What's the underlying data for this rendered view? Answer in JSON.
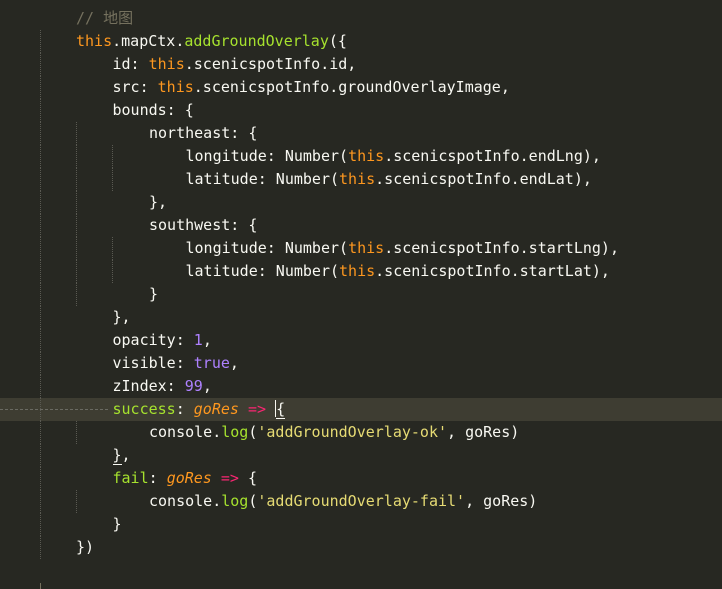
{
  "editor": {
    "lines": [
      [
        {
          "t": "// 地图",
          "c": "c-comment"
        }
      ],
      [
        {
          "t": "this",
          "c": "c-this"
        },
        {
          "t": ".mapCtx.",
          "c": "c-text"
        },
        {
          "t": "addGroundOverlay",
          "c": "c-func"
        },
        {
          "t": "({",
          "c": "c-text"
        }
      ],
      [
        {
          "t": "id: ",
          "c": "c-text"
        },
        {
          "t": "this",
          "c": "c-this"
        },
        {
          "t": ".scenicspotInfo.id,",
          "c": "c-text"
        }
      ],
      [
        {
          "t": "src: ",
          "c": "c-text"
        },
        {
          "t": "this",
          "c": "c-this"
        },
        {
          "t": ".scenicspotInfo.groundOverlayImage,",
          "c": "c-text"
        }
      ],
      [
        {
          "t": "bounds: {",
          "c": "c-text"
        }
      ],
      [
        {
          "t": "northeast: {",
          "c": "c-text"
        }
      ],
      [
        {
          "t": "longitude: Number(",
          "c": "c-text"
        },
        {
          "t": "this",
          "c": "c-this"
        },
        {
          "t": ".scenicspotInfo.endLng),",
          "c": "c-text"
        }
      ],
      [
        {
          "t": "latitude: Number(",
          "c": "c-text"
        },
        {
          "t": "this",
          "c": "c-this"
        },
        {
          "t": ".scenicspotInfo.endLat),",
          "c": "c-text"
        }
      ],
      [
        {
          "t": "},",
          "c": "c-text"
        }
      ],
      [
        {
          "t": "southwest: {",
          "c": "c-text"
        }
      ],
      [
        {
          "t": "longitude: Number(",
          "c": "c-text"
        },
        {
          "t": "this",
          "c": "c-this"
        },
        {
          "t": ".scenicspotInfo.startLng),",
          "c": "c-text"
        }
      ],
      [
        {
          "t": "latitude: Number(",
          "c": "c-text"
        },
        {
          "t": "this",
          "c": "c-this"
        },
        {
          "t": ".scenicspotInfo.startLat),",
          "c": "c-text"
        }
      ],
      [
        {
          "t": "}",
          "c": "c-text"
        }
      ],
      [
        {
          "t": "},",
          "c": "c-text"
        }
      ],
      [
        {
          "t": "opacity: ",
          "c": "c-text"
        },
        {
          "t": "1",
          "c": "c-num"
        },
        {
          "t": ",",
          "c": "c-text"
        }
      ],
      [
        {
          "t": "visible: ",
          "c": "c-text"
        },
        {
          "t": "true",
          "c": "c-bool"
        },
        {
          "t": ",",
          "c": "c-text"
        }
      ],
      [
        {
          "t": "zIndex: ",
          "c": "c-text"
        },
        {
          "t": "99",
          "c": "c-num"
        },
        {
          "t": ",",
          "c": "c-text"
        }
      ],
      [
        {
          "t": "success",
          "c": "c-func"
        },
        {
          "t": ": ",
          "c": "c-text"
        },
        {
          "t": "goRes",
          "c": "c-param"
        },
        {
          "t": " ",
          "c": "c-text"
        },
        {
          "t": "=>",
          "c": "c-op"
        },
        {
          "t": " ",
          "c": "c-text"
        },
        {
          "t": "{",
          "c": "c-text bracket-match"
        }
      ],
      [
        {
          "t": "console.",
          "c": "c-text"
        },
        {
          "t": "log",
          "c": "c-func"
        },
        {
          "t": "(",
          "c": "c-text"
        },
        {
          "t": "'addGroundOverlay-ok'",
          "c": "c-str"
        },
        {
          "t": ", goRes)",
          "c": "c-text"
        }
      ],
      [
        {
          "t": "}",
          "c": "c-text bracket-match"
        },
        {
          "t": ",",
          "c": "c-text"
        }
      ],
      [
        {
          "t": "fail",
          "c": "c-func"
        },
        {
          "t": ": ",
          "c": "c-text"
        },
        {
          "t": "goRes",
          "c": "c-param"
        },
        {
          "t": " ",
          "c": "c-text"
        },
        {
          "t": "=>",
          "c": "c-op"
        },
        {
          "t": " {",
          "c": "c-text"
        }
      ],
      [
        {
          "t": "console.",
          "c": "c-text"
        },
        {
          "t": "log",
          "c": "c-func"
        },
        {
          "t": "(",
          "c": "c-text"
        },
        {
          "t": "'addGroundOverlay-fail'",
          "c": "c-str"
        },
        {
          "t": ", goRes)",
          "c": "c-text"
        }
      ],
      [
        {
          "t": "}",
          "c": "c-text"
        }
      ],
      [
        {
          "t": "})",
          "c": "c-text"
        }
      ]
    ],
    "colors": {
      "background": "#272822",
      "active_line": "#3e3d32",
      "comment": "#75715e",
      "keyword_this": "#fd971f",
      "function": "#a6e22e",
      "number": "#ae81ff",
      "string": "#e6db74",
      "operator": "#f92672"
    }
  }
}
